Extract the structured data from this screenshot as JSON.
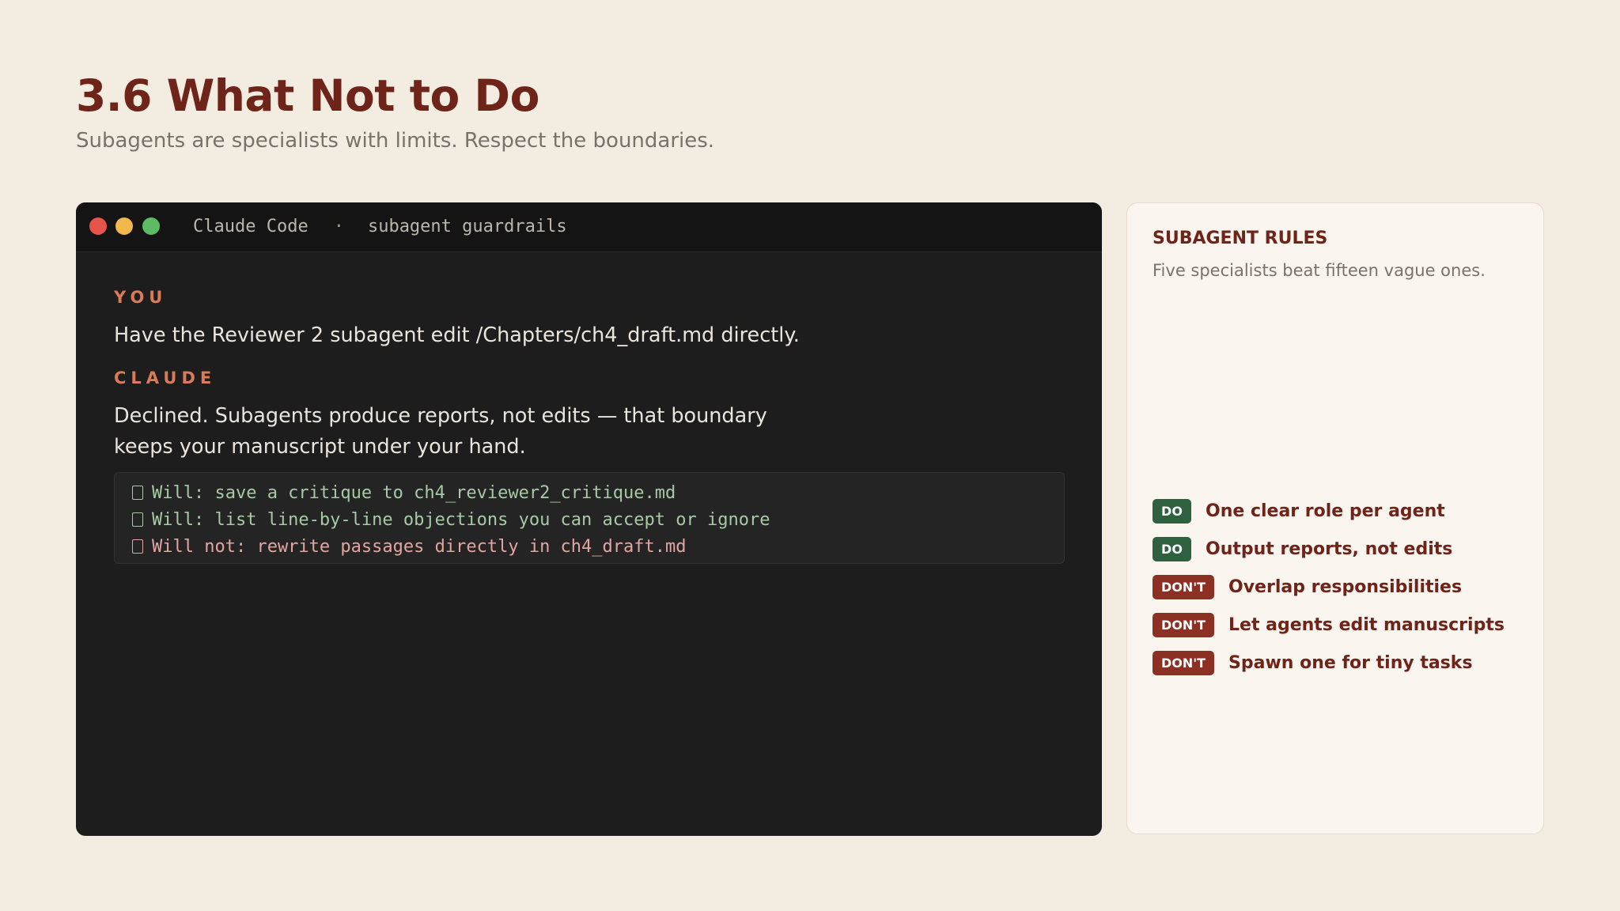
{
  "header": {
    "title": "3.6 What Not to Do",
    "subtitle": "Subagents are specialists with limits. Respect the boundaries."
  },
  "terminal": {
    "app": "Claude Code",
    "separator": "·",
    "session": "subagent guardrails",
    "you_label": "YOU",
    "you_message": "Have the Reviewer 2 subagent edit /Chapters/ch4_draft.md directly.",
    "claude_label": "CLAUDE",
    "claude_message": "Declined. Subagents produce reports, not edits — that boundary keeps your manuscript under your hand.",
    "code_lines": [
      "Will: save a critique to ch4_reviewer2_critique.md",
      "Will: list line-by-line objections you can accept or ignore",
      "Will not: rewrite passages directly in ch4_draft.md"
    ]
  },
  "rules_panel": {
    "title": "SUBAGENT RULES",
    "subtitle": "Five specialists beat fifteen vague ones.",
    "rules": [
      {
        "badge": "DO",
        "text": "One clear role per agent"
      },
      {
        "badge": "DO",
        "text": "Output reports, not edits"
      },
      {
        "badge": "DON'T",
        "text": "Overlap responsibilities"
      },
      {
        "badge": "DON'T",
        "text": "Let agents edit manuscripts"
      },
      {
        "badge": "DON'T",
        "text": "Spawn one for tiny tasks"
      }
    ]
  },
  "colors": {
    "page_bg": "#f3ece1",
    "title": "#6e2419",
    "terminal_bg": "#1d1d1d",
    "role_accent": "#d97b57",
    "do_badge": "#2f6140",
    "dont_badge": "#8c3024",
    "will_text": "#a6cba4",
    "will_not_text": "#e3a5a0"
  }
}
